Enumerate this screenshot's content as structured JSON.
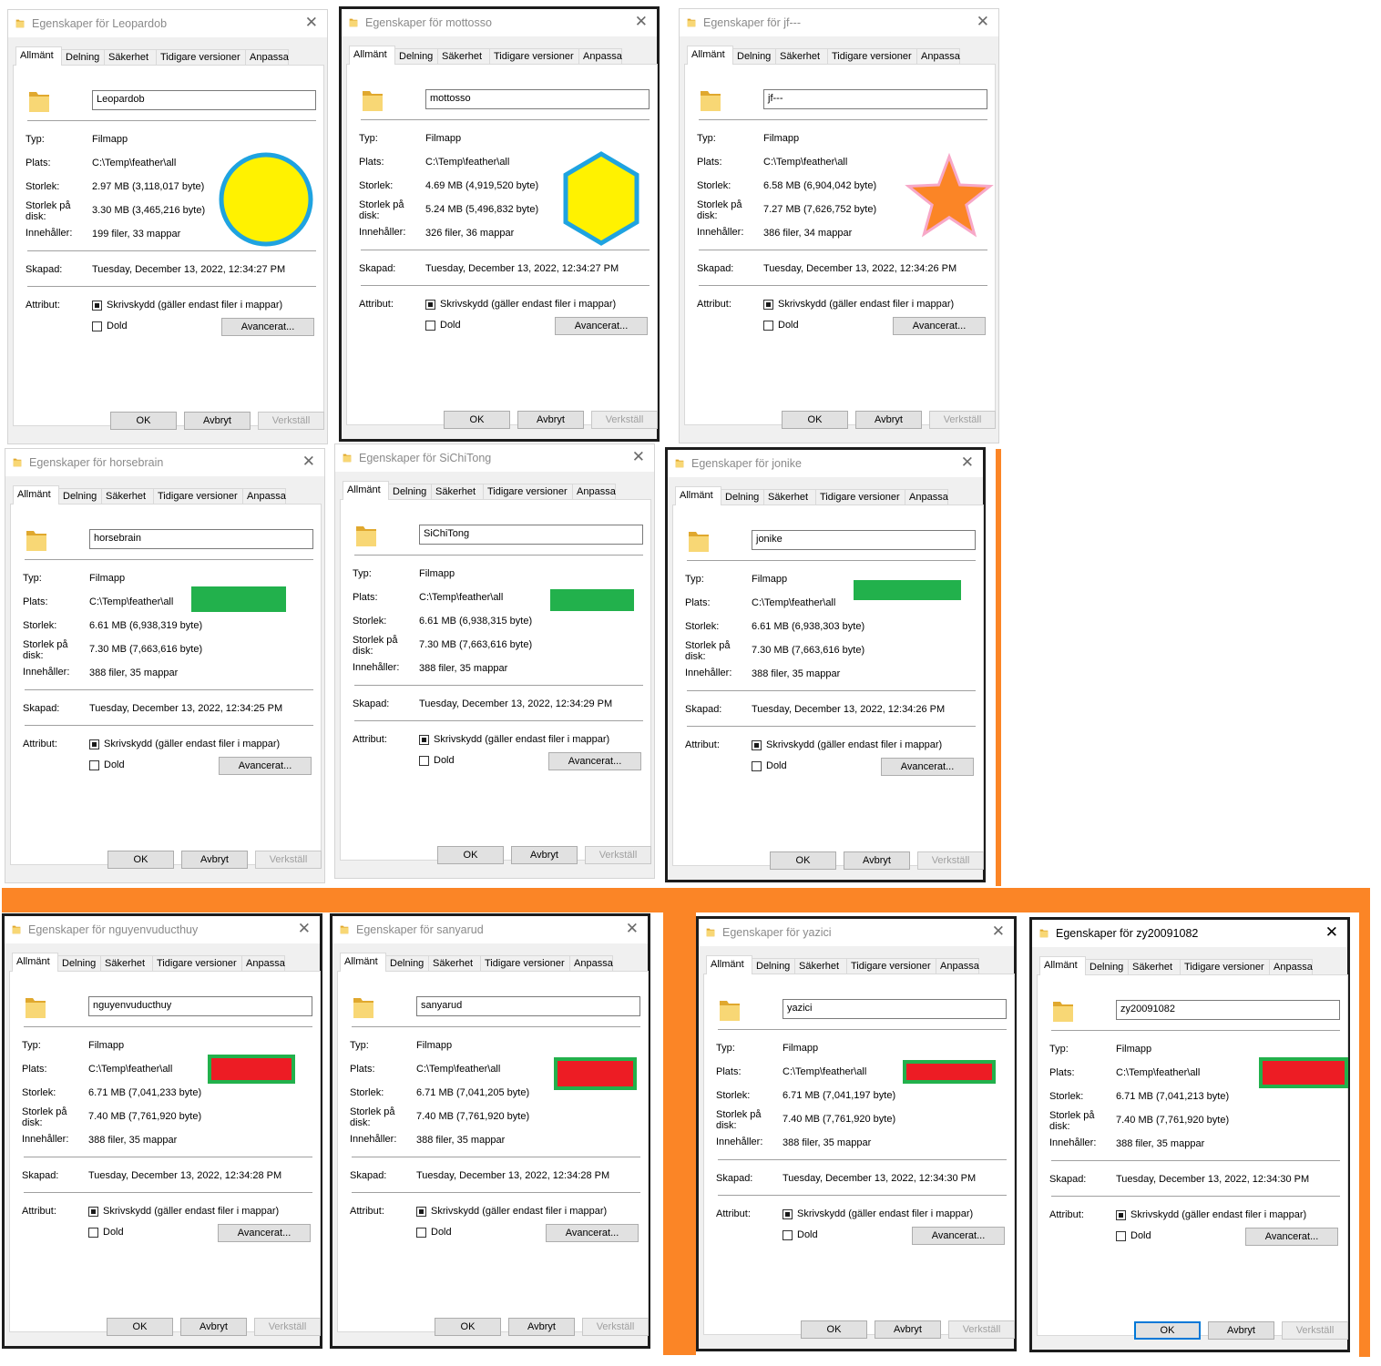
{
  "common": {
    "tabs": [
      "Allmänt",
      "Delning",
      "Säkerhet",
      "Tidigare versioner",
      "Anpassa"
    ],
    "labels": {
      "type": "Typ:",
      "location": "Plats:",
      "size": "Storlek:",
      "size_on_disk": "Storlek på disk:",
      "contains": "Innehåller:",
      "created": "Skapad:",
      "attributes": "Attribut:"
    },
    "type_value": "Filmapp",
    "location_value": "C:\\Temp\\feather\\all",
    "readonly_label": "Skrivskydd (gäller endast filer i mappar)",
    "hidden_label": "Dold",
    "advanced_label": "Avancerat...",
    "ok_label": "OK",
    "cancel_label": "Avbryt",
    "apply_label": "Verkställ"
  },
  "dialogs": [
    {
      "title": "Egenskaper för Leopardob",
      "name": "Leopardob",
      "size": "2.97 MB (3,118,017 byte)",
      "size_on_disk": "3.30 MB (3,465,216 byte)",
      "contains": "199 filer, 33 mappar",
      "created": "Tuesday, December 13, 2022, 12:34:27 PM",
      "shape": "circle",
      "shape_fill": "#fff200",
      "shape_stroke": "#1fa3e0"
    },
    {
      "title": "Egenskaper för mottosso",
      "name": "mottosso",
      "size": "4.69 MB (4,919,520 byte)",
      "size_on_disk": "5.24 MB (5,496,832 byte)",
      "contains": "326 filer, 36 mappar",
      "created": "Tuesday, December 13, 2022, 12:34:27 PM",
      "shape": "hexagon",
      "shape_fill": "#fff200",
      "shape_stroke": "#1fa3e0"
    },
    {
      "title": "Egenskaper för jf---",
      "name": "jf---",
      "size": "6.58 MB (6,904,042 byte)",
      "size_on_disk": "7.27 MB (7,626,752 byte)",
      "contains": "386 filer, 34 mappar",
      "created": "Tuesday, December 13, 2022, 12:34:26 PM",
      "shape": "star",
      "shape_fill": "#fb8526",
      "shape_stroke": "#f7a8c8"
    },
    {
      "title": "Egenskaper för horsebrain",
      "name": "horsebrain",
      "size": "6.61 MB (6,938,319 byte)",
      "size_on_disk": "7.30 MB (7,663,616 byte)",
      "contains": "388 filer, 35 mappar",
      "created": "Tuesday, December 13, 2022, 12:34:25 PM",
      "shape": "rect",
      "shape_fill": "#22b14c",
      "shape_stroke": "#22b14c"
    },
    {
      "title": "Egenskaper för SiChiTong",
      "name": "SiChiTong",
      "size": "6.61 MB (6,938,315 byte)",
      "size_on_disk": "7.30 MB (7,663,616 byte)",
      "contains": "388 filer, 35 mappar",
      "created": "Tuesday, December 13, 2022, 12:34:29 PM",
      "shape": "rect",
      "shape_fill": "#22b14c",
      "shape_stroke": "#22b14c"
    },
    {
      "title": "Egenskaper för jonike",
      "name": "jonike",
      "size": "6.61 MB (6,938,303 byte)",
      "size_on_disk": "7.30 MB (7,663,616 byte)",
      "contains": "388 filer, 35 mappar",
      "created": "Tuesday, December 13, 2022, 12:34:26 PM",
      "shape": "rect",
      "shape_fill": "#22b14c",
      "shape_stroke": "#22b14c"
    },
    {
      "title": "Egenskaper för nguyenvuducthuy",
      "name": "nguyenvuducthuy",
      "size": "6.71 MB (7,041,233 byte)",
      "size_on_disk": "7.40 MB (7,761,920 byte)",
      "contains": "388 filer, 35 mappar",
      "created": "Tuesday, December 13, 2022, 12:34:28 PM",
      "shape": "rect-bordered",
      "shape_fill": "#ed1c24",
      "shape_stroke": "#22b14c"
    },
    {
      "title": "Egenskaper för sanyarud",
      "name": "sanyarud",
      "size": "6.71 MB (7,041,205 byte)",
      "size_on_disk": "7.40 MB (7,761,920 byte)",
      "contains": "388 filer, 35 mappar",
      "created": "Tuesday, December 13, 2022, 12:34:28 PM",
      "shape": "rect-bordered",
      "shape_fill": "#ed1c24",
      "shape_stroke": "#22b14c"
    },
    {
      "title": "Egenskaper för yazici",
      "name": "yazici",
      "size": "6.71 MB (7,041,197 byte)",
      "size_on_disk": "7.40 MB (7,761,920 byte)",
      "contains": "388 filer, 35 mappar",
      "created": "Tuesday, December 13, 2022, 12:34:30 PM",
      "shape": "rect-bordered",
      "shape_fill": "#ed1c24",
      "shape_stroke": "#22b14c"
    },
    {
      "title": "Egenskaper för zy20091082",
      "name": "zy20091082",
      "size": "6.71 MB (7,041,213 byte)",
      "size_on_disk": "7.40 MB (7,761,920 byte)",
      "contains": "388 filer, 35 mappar",
      "created": "Tuesday, December 13, 2022, 12:34:30 PM",
      "shape": "rect-bordered",
      "shape_fill": "#ed1c24",
      "shape_stroke": "#22b14c"
    }
  ],
  "colors": {
    "band": "#fb8526",
    "focus": "#0078d7",
    "folder": "#f8d775",
    "folder_dark": "#e0a82e"
  }
}
